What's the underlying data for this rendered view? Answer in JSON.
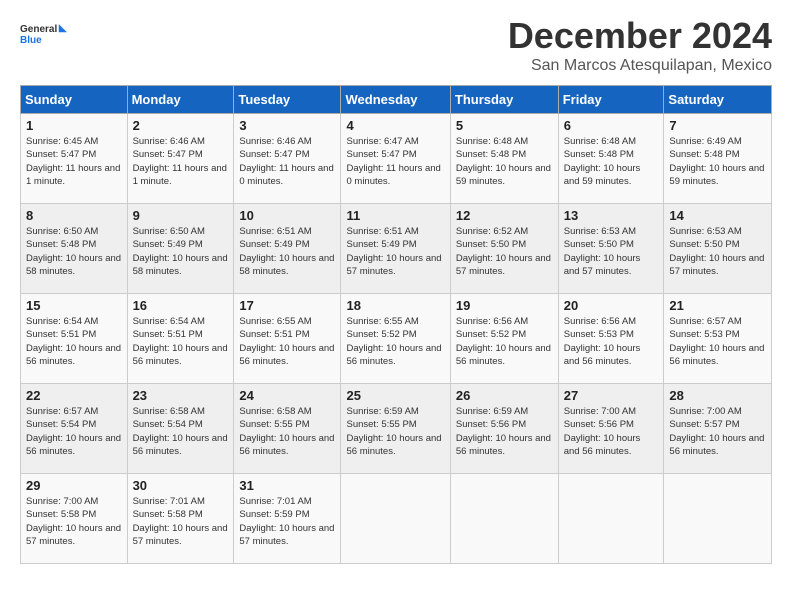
{
  "logo": {
    "general": "General",
    "blue": "Blue"
  },
  "title": "December 2024",
  "location": "San Marcos Atesquilapan, Mexico",
  "weekdays": [
    "Sunday",
    "Monday",
    "Tuesday",
    "Wednesday",
    "Thursday",
    "Friday",
    "Saturday"
  ],
  "weeks": [
    [
      {
        "day": "1",
        "sunrise": "6:45 AM",
        "sunset": "5:47 PM",
        "daylight": "11 hours and 1 minute."
      },
      {
        "day": "2",
        "sunrise": "6:46 AM",
        "sunset": "5:47 PM",
        "daylight": "11 hours and 1 minute."
      },
      {
        "day": "3",
        "sunrise": "6:46 AM",
        "sunset": "5:47 PM",
        "daylight": "11 hours and 0 minutes."
      },
      {
        "day": "4",
        "sunrise": "6:47 AM",
        "sunset": "5:47 PM",
        "daylight": "11 hours and 0 minutes."
      },
      {
        "day": "5",
        "sunrise": "6:48 AM",
        "sunset": "5:48 PM",
        "daylight": "10 hours and 59 minutes."
      },
      {
        "day": "6",
        "sunrise": "6:48 AM",
        "sunset": "5:48 PM",
        "daylight": "10 hours and 59 minutes."
      },
      {
        "day": "7",
        "sunrise": "6:49 AM",
        "sunset": "5:48 PM",
        "daylight": "10 hours and 59 minutes."
      }
    ],
    [
      {
        "day": "8",
        "sunrise": "6:50 AM",
        "sunset": "5:48 PM",
        "daylight": "10 hours and 58 minutes."
      },
      {
        "day": "9",
        "sunrise": "6:50 AM",
        "sunset": "5:49 PM",
        "daylight": "10 hours and 58 minutes."
      },
      {
        "day": "10",
        "sunrise": "6:51 AM",
        "sunset": "5:49 PM",
        "daylight": "10 hours and 58 minutes."
      },
      {
        "day": "11",
        "sunrise": "6:51 AM",
        "sunset": "5:49 PM",
        "daylight": "10 hours and 57 minutes."
      },
      {
        "day": "12",
        "sunrise": "6:52 AM",
        "sunset": "5:50 PM",
        "daylight": "10 hours and 57 minutes."
      },
      {
        "day": "13",
        "sunrise": "6:53 AM",
        "sunset": "5:50 PM",
        "daylight": "10 hours and 57 minutes."
      },
      {
        "day": "14",
        "sunrise": "6:53 AM",
        "sunset": "5:50 PM",
        "daylight": "10 hours and 57 minutes."
      }
    ],
    [
      {
        "day": "15",
        "sunrise": "6:54 AM",
        "sunset": "5:51 PM",
        "daylight": "10 hours and 56 minutes."
      },
      {
        "day": "16",
        "sunrise": "6:54 AM",
        "sunset": "5:51 PM",
        "daylight": "10 hours and 56 minutes."
      },
      {
        "day": "17",
        "sunrise": "6:55 AM",
        "sunset": "5:51 PM",
        "daylight": "10 hours and 56 minutes."
      },
      {
        "day": "18",
        "sunrise": "6:55 AM",
        "sunset": "5:52 PM",
        "daylight": "10 hours and 56 minutes."
      },
      {
        "day": "19",
        "sunrise": "6:56 AM",
        "sunset": "5:52 PM",
        "daylight": "10 hours and 56 minutes."
      },
      {
        "day": "20",
        "sunrise": "6:56 AM",
        "sunset": "5:53 PM",
        "daylight": "10 hours and 56 minutes."
      },
      {
        "day": "21",
        "sunrise": "6:57 AM",
        "sunset": "5:53 PM",
        "daylight": "10 hours and 56 minutes."
      }
    ],
    [
      {
        "day": "22",
        "sunrise": "6:57 AM",
        "sunset": "5:54 PM",
        "daylight": "10 hours and 56 minutes."
      },
      {
        "day": "23",
        "sunrise": "6:58 AM",
        "sunset": "5:54 PM",
        "daylight": "10 hours and 56 minutes."
      },
      {
        "day": "24",
        "sunrise": "6:58 AM",
        "sunset": "5:55 PM",
        "daylight": "10 hours and 56 minutes."
      },
      {
        "day": "25",
        "sunrise": "6:59 AM",
        "sunset": "5:55 PM",
        "daylight": "10 hours and 56 minutes."
      },
      {
        "day": "26",
        "sunrise": "6:59 AM",
        "sunset": "5:56 PM",
        "daylight": "10 hours and 56 minutes."
      },
      {
        "day": "27",
        "sunrise": "7:00 AM",
        "sunset": "5:56 PM",
        "daylight": "10 hours and 56 minutes."
      },
      {
        "day": "28",
        "sunrise": "7:00 AM",
        "sunset": "5:57 PM",
        "daylight": "10 hours and 56 minutes."
      }
    ],
    [
      {
        "day": "29",
        "sunrise": "7:00 AM",
        "sunset": "5:58 PM",
        "daylight": "10 hours and 57 minutes."
      },
      {
        "day": "30",
        "sunrise": "7:01 AM",
        "sunset": "5:58 PM",
        "daylight": "10 hours and 57 minutes."
      },
      {
        "day": "31",
        "sunrise": "7:01 AM",
        "sunset": "5:59 PM",
        "daylight": "10 hours and 57 minutes."
      },
      null,
      null,
      null,
      null
    ]
  ]
}
